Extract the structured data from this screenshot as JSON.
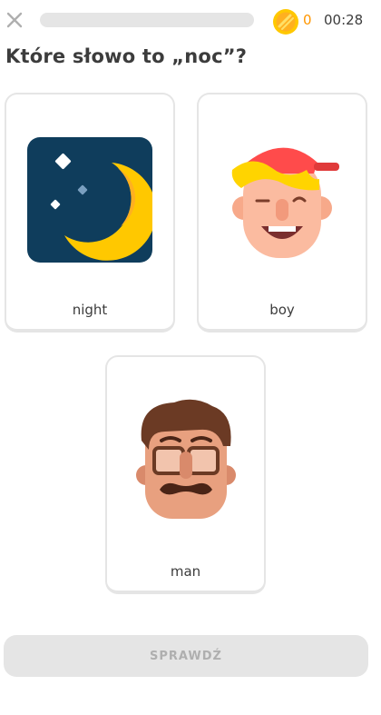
{
  "header": {
    "close_icon": "close-icon",
    "progress_fraction": 0,
    "gem_icon": "coin-icon",
    "gem_count": "0",
    "timer": "00:28"
  },
  "question": "Które słowo to „noc”?",
  "choices": [
    {
      "label": "night",
      "icon": "moon-icon"
    },
    {
      "label": "boy",
      "icon": "boy-with-cap-icon"
    },
    {
      "label": "man",
      "icon": "man-with-glasses-icon"
    }
  ],
  "check_button": {
    "label": "SPRAWDŹ"
  },
  "colors": {
    "accent_gold": "#ffc800",
    "gem_count": "#ff9600",
    "card_border": "#e5e5e5",
    "button_disabled_bg": "#e5e5e5",
    "button_disabled_text": "#afafaf",
    "night_bg": "#0f3d5c"
  }
}
